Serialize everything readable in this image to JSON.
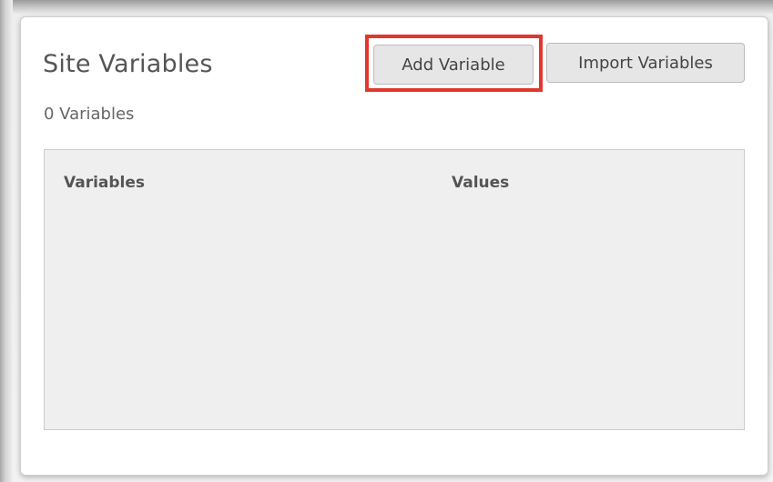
{
  "panel": {
    "title": "Site Variables",
    "count_label": "0 Variables"
  },
  "toolbar": {
    "add_label": "Add Variable",
    "import_label": "Import Variables"
  },
  "table": {
    "columns": [
      "Variables",
      "Values"
    ],
    "rows": []
  },
  "colors": {
    "highlight": "#e0382c",
    "button_bg": "#e6e6e6",
    "table_bg": "#efefef"
  }
}
